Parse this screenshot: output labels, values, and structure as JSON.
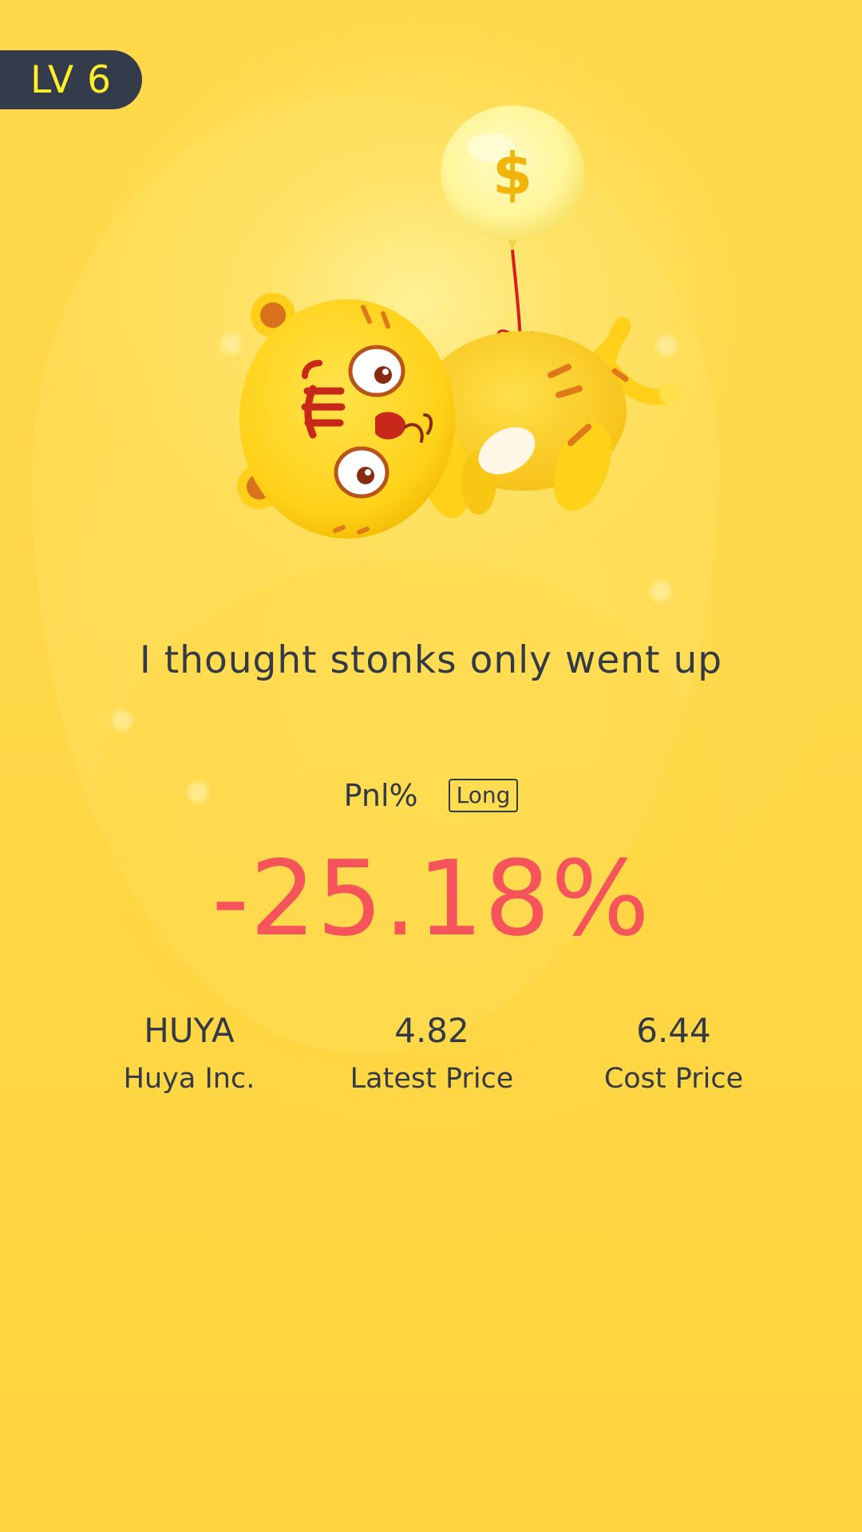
{
  "level": {
    "label": "LV 6"
  },
  "illustration": {
    "icon": "tiger-with-dollar-balloon-icon",
    "balloon_symbol": "$"
  },
  "headline": "I thought stonks only went up",
  "pnl": {
    "label": "Pnl%",
    "direction": "Long",
    "value": "-25.18%"
  },
  "stats": [
    {
      "value": "HUYA",
      "label": "Huya Inc."
    },
    {
      "value": "4.82",
      "label": "Latest Price"
    },
    {
      "value": "6.44",
      "label": "Cost Price"
    }
  ],
  "colors": {
    "background": "#ffd94a",
    "badge_bg": "#343b4a",
    "badge_text": "#ffee2a",
    "text": "#333a45",
    "loss": "#f5555a"
  }
}
